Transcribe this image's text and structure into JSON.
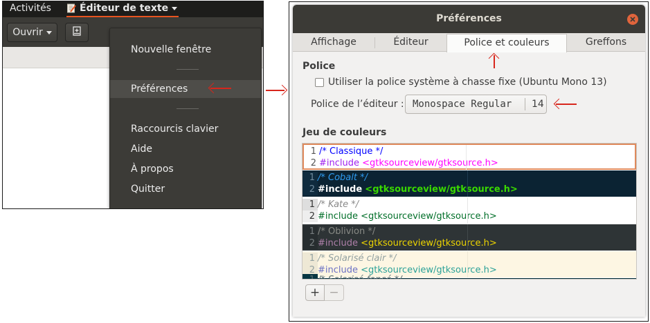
{
  "colors": {
    "accent": "#e95420",
    "arrow": "#d8261c",
    "selection_border": "#e08a5c",
    "titlebar": "#3b3a36",
    "close": "#e0643c"
  },
  "topbar": {
    "activities": "Activités",
    "app_menu_label": "Éditeur de texte",
    "app_icon": "text-editor-icon"
  },
  "toolbar": {
    "open_label": "Ouvrir",
    "save_icon": "save-icon"
  },
  "app_menu": {
    "items": [
      {
        "label": "Nouvelle fenêtre"
      },
      {
        "label": "Préférences",
        "active": true
      },
      {
        "label": "Raccourcis clavier"
      },
      {
        "label": "Aide"
      },
      {
        "label": "À propos"
      },
      {
        "label": "Quitter"
      }
    ]
  },
  "prefs": {
    "title": "Préférences",
    "tabs": [
      "Affichage",
      "Éditeur",
      "Police et couleurs",
      "Greffons"
    ],
    "active_tab": "Police et couleurs",
    "font_section": {
      "heading": "Police",
      "system_mono_label": "Utiliser la police système à chasse fixe (Ubuntu Mono 13)",
      "system_mono_checked": false,
      "editor_font_label": "Police de l’éditeur :",
      "font_name": "Monospace Regular",
      "font_size": "14"
    },
    "color_section": {
      "heading": "Jeu de couleurs",
      "schemes": [
        {
          "comment": "/* Classique */",
          "include": "#include",
          "path": "<gtksourceview/gtksource.h>",
          "selected": true
        },
        {
          "comment": "/* Cobalt */",
          "include": "#include",
          "path": "<gtksourceview/gtksource.h>"
        },
        {
          "comment": "/* Kate */",
          "include": "#include",
          "path": "<gtksourceview/gtksource.h>"
        },
        {
          "comment": "/* Oblivion */",
          "include": "#include",
          "path": "<gtksourceview/gtksource.h>"
        },
        {
          "comment": "/* Solarisé clair */",
          "include": "#include",
          "path": "<gtksourceview/gtksource.h>"
        },
        {
          "comment": "/* Solarisé foncé */"
        }
      ],
      "line_numbers": [
        "1",
        "2"
      ]
    },
    "add_label": "+",
    "remove_label": "−"
  }
}
